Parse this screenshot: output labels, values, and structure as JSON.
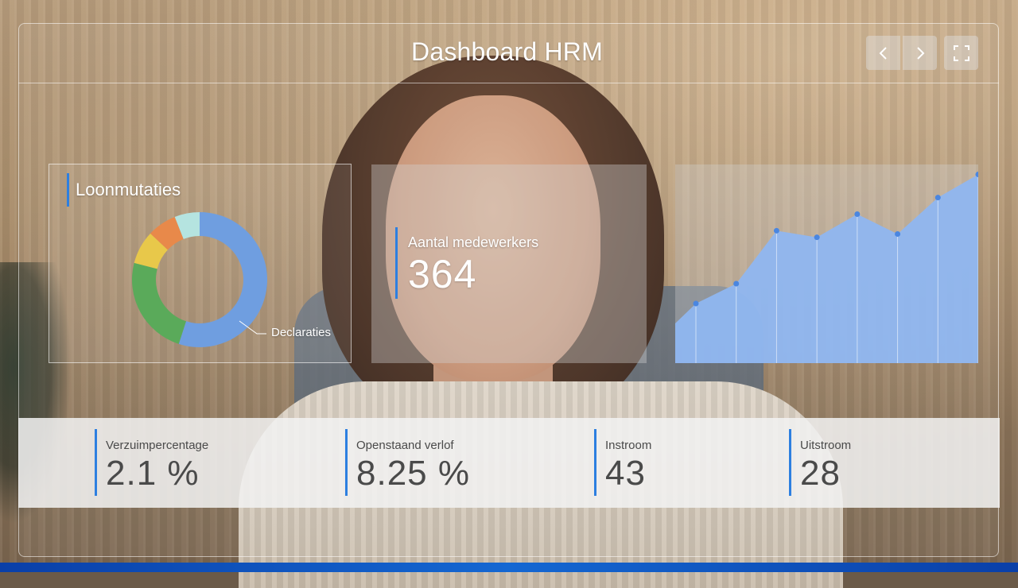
{
  "header": {
    "title": "Dashboard HRM",
    "prev_icon": "chevron-left-icon",
    "next_icon": "chevron-right-icon",
    "fullscreen_icon": "fullscreen-icon"
  },
  "colors": {
    "accent": "#2d7fe0",
    "donut": [
      "#6f9ee0",
      "#5aaa5a",
      "#e8c84a",
      "#e8894a",
      "#b5e4e0"
    ],
    "area_fill": "#8fb6f0",
    "area_point": "#4a86e0"
  },
  "loonmutaties": {
    "title": "Loonmutaties",
    "label": "Declaraties"
  },
  "medewerkers": {
    "label": "Aantal medewerkers",
    "value": "364"
  },
  "kpis": [
    {
      "label": "Verzuimpercentage",
      "value": "2.1 %"
    },
    {
      "label": "Openstaand verlof",
      "value": "8.25 %"
    },
    {
      "label": "Instroom",
      "value": "43"
    },
    {
      "label": "Uitstroom",
      "value": "28"
    }
  ],
  "chart_data": [
    {
      "type": "pie",
      "title": "Loonmutaties",
      "labels": [
        "Declaraties",
        "",
        "",
        "",
        ""
      ],
      "values": [
        55,
        24,
        8,
        7,
        6
      ],
      "colors": [
        "#6f9ee0",
        "#5aaa5a",
        "#e8c84a",
        "#e8894a",
        "#b5e4e0"
      ]
    },
    {
      "type": "area",
      "x": [
        1,
        2,
        3,
        4,
        5,
        6,
        7,
        8
      ],
      "values": [
        18,
        24,
        40,
        38,
        45,
        39,
        50,
        57
      ],
      "ylim": [
        0,
        60
      ],
      "grid": true
    }
  ]
}
